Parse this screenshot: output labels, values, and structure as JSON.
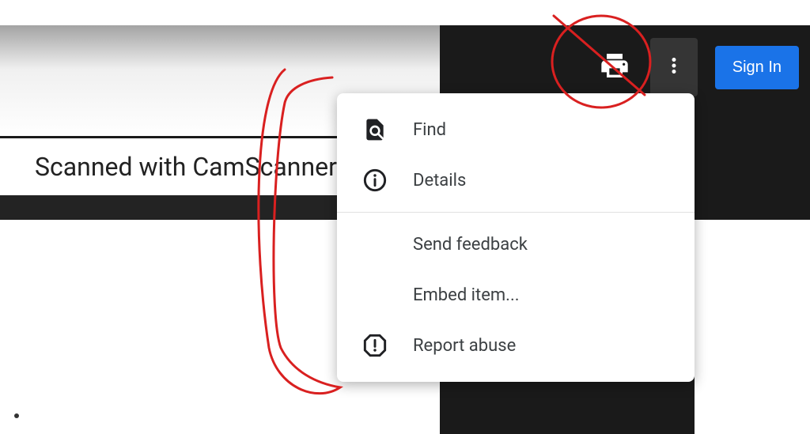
{
  "document": {
    "watermark": "Scanned with CamScanner"
  },
  "toolbar": {
    "print_label": "Print",
    "more_label": "More actions",
    "sign_in_label": "Sign In"
  },
  "menu": {
    "find": "Find",
    "details": "Details",
    "send_feedback": "Send feedback",
    "embed_item": "Embed item...",
    "report_abuse": "Report abuse"
  }
}
